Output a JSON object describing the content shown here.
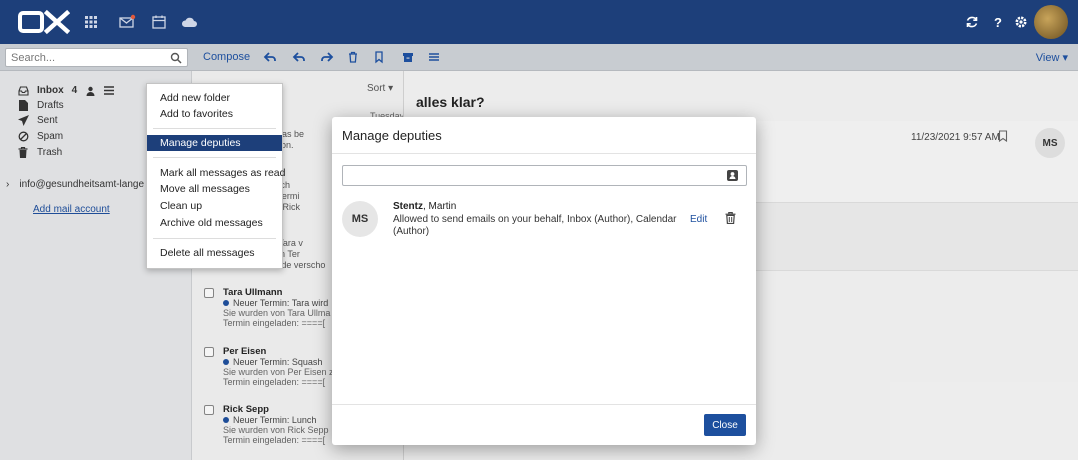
{
  "topbar": {
    "logo_text": "OX",
    "icons": [
      "apps-grid-icon",
      "mail-icon",
      "calendar-icon",
      "cloud-icon"
    ],
    "right_icons": [
      "refresh-icon",
      "help-icon",
      "settings-icon",
      "user-avatar"
    ],
    "colors": {
      "bar": "#1d3f7a",
      "badge": "#e05a3c"
    }
  },
  "toolbar": {
    "search_placeholder": "Search...",
    "compose_label": "Compose",
    "view_label": "View ▾"
  },
  "sidebar": {
    "folders": [
      {
        "label": "Inbox",
        "count": "4",
        "icon": "inbox-icon"
      },
      {
        "label": "Drafts",
        "icon": "drafts-icon"
      },
      {
        "label": "Sent",
        "icon": "sent-icon"
      },
      {
        "label": "Spam",
        "icon": "spam-icon"
      },
      {
        "label": "Trash",
        "icon": "trash-icon"
      }
    ],
    "account": "info@gesundheitsamt-lange",
    "add_account": "Add mail account"
  },
  "menu": {
    "items": [
      "Add new folder",
      "Add to favorites",
      "Manage deputies",
      "Mark all messages as read",
      "Move all messages",
      "Clean up",
      "Archive old messages",
      "Delete all messages"
    ],
    "active_index": 2
  },
  "maillist": {
    "sort_label": "Sort ▾",
    "date_label": "Tuesday",
    "snippets": [
      "mail has be",
      "r person.",
      "t: Lunch",
      "inen Termi",
      "g von Rick",
      "dert: Tara v",
      "t einen Ter",
      "ber Termin wurde verscho"
    ],
    "items": [
      {
        "from": "Tara Ullmann",
        "subject": "Neuer Termin: Tara wird",
        "line2": "Sie wurden von Tara Ullma",
        "line3": "Termin eingeladen: ====["
      },
      {
        "from": "Per Eisen",
        "subject": "Neuer Termin: Squash",
        "line2": "Sie wurden von Per Eisen z",
        "line3": "Termin eingeladen: ====["
      },
      {
        "from": "Rick Sepp",
        "subject": "Neuer Termin: Lunch",
        "line2": "Sie wurden von Rick Sepp",
        "line3": "Termin eingeladen: ====["
      }
    ]
  },
  "reader": {
    "subject": "alles klar?",
    "date": "11/23/2021 9:57 AM",
    "avatar_initials": "MS"
  },
  "modal": {
    "title": "Manage deputies",
    "input_placeholder": "",
    "deputy": {
      "initials": "MS",
      "last_name": "Stentz",
      "first_name": ", Martin",
      "permissions": "Allowed to send emails on your behalf, Inbox (Author), Calendar (Author)",
      "edit_label": "Edit"
    },
    "close_label": "Close"
  }
}
